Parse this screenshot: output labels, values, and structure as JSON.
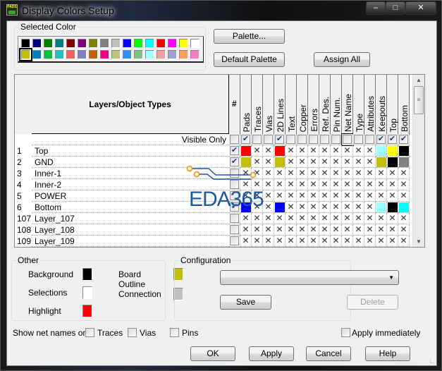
{
  "window": {
    "title": "Display Colors Setup",
    "icon_text": "PADS",
    "controls": [
      "minimize",
      "maximize",
      "close"
    ]
  },
  "selected_color": {
    "label": "Selected Color",
    "selected_index": 16,
    "palette": [
      "#000000",
      "#000080",
      "#008000",
      "#008080",
      "#800000",
      "#800080",
      "#808000",
      "#808080",
      "#c0c0c0",
      "#0000ff",
      "#00ff00",
      "#00ffff",
      "#ff0000",
      "#ff00ff",
      "#ffff00",
      "#ffffff",
      "#c0c000",
      "#0080c0",
      "#00c040",
      "#20c0c0",
      "#f06060",
      "#8080c0",
      "#c06010",
      "#f00080",
      "#c0c080",
      "#3090f0",
      "#80c080",
      "#a0ffff",
      "#f0a0a0",
      "#a0a0d0",
      "#ffa060",
      "#f080c0"
    ]
  },
  "buttons": {
    "palette": "Palette...",
    "default_palette": "Default Palette",
    "assign_all": "Assign All",
    "save": "Save",
    "delete": "Delete",
    "ok": "OK",
    "apply": "Apply",
    "cancel": "Cancel",
    "help": "Help"
  },
  "grid": {
    "header": "Layers/Object Types",
    "visible_only": "Visible Only",
    "columns": [
      "#",
      "Pads",
      "Traces",
      "Vias",
      "2D Lines",
      "Text",
      "Copper",
      "Errors",
      "Ref. Des.",
      "Pin Num.",
      "Net Name",
      "Type",
      "Attributes",
      "Keepouts",
      "Top",
      "Bottom"
    ],
    "visible_only_checks": [
      false,
      true,
      false,
      false,
      true,
      false,
      false,
      false,
      false,
      false,
      false,
      false,
      false,
      true,
      true,
      true
    ],
    "rows": [
      {
        "num": "1",
        "name": "Top",
        "checked": true,
        "cells": [
          "#ff0000",
          null,
          null,
          "#ff0000",
          null,
          null,
          null,
          null,
          null,
          null,
          null,
          null,
          "#99ffff",
          "#ffff00",
          "#000000"
        ]
      },
      {
        "num": "2",
        "name": "GND",
        "checked": true,
        "cells": [
          "#c0c000",
          null,
          null,
          "#c0c000",
          null,
          null,
          null,
          null,
          null,
          null,
          null,
          null,
          "#c0c000",
          "#000000",
          "#808080"
        ]
      },
      {
        "num": "3",
        "name": "Inner-1",
        "checked": false,
        "cells": [
          null,
          null,
          null,
          null,
          null,
          null,
          null,
          null,
          null,
          null,
          null,
          null,
          null,
          null,
          null
        ]
      },
      {
        "num": "4",
        "name": "Inner-2",
        "checked": false,
        "cells": [
          null,
          null,
          null,
          null,
          null,
          null,
          null,
          null,
          null,
          null,
          null,
          null,
          null,
          null,
          null
        ]
      },
      {
        "num": "5",
        "name": "POWER",
        "checked": false,
        "cells": [
          null,
          null,
          null,
          null,
          null,
          null,
          null,
          null,
          null,
          null,
          null,
          null,
          null,
          null,
          null
        ]
      },
      {
        "num": "6",
        "name": "Bottom",
        "checked": true,
        "cells": [
          "#0000ff",
          null,
          null,
          "#0000ff",
          null,
          null,
          null,
          null,
          null,
          null,
          null,
          null,
          "#99ffff",
          "#000000",
          "#00ffff"
        ]
      },
      {
        "num": "107",
        "name": "Layer_107",
        "checked": false,
        "cells": [
          null,
          null,
          null,
          null,
          null,
          null,
          null,
          null,
          null,
          null,
          null,
          null,
          null,
          null,
          null
        ]
      },
      {
        "num": "108",
        "name": "Layer_108",
        "checked": false,
        "cells": [
          null,
          null,
          null,
          null,
          null,
          null,
          null,
          null,
          null,
          null,
          null,
          null,
          null,
          null,
          null
        ]
      },
      {
        "num": "109",
        "name": "Layer_109",
        "checked": false,
        "cells": [
          null,
          null,
          null,
          null,
          null,
          null,
          null,
          null,
          null,
          null,
          null,
          null,
          null,
          null,
          null
        ]
      }
    ]
  },
  "other": {
    "label": "Other",
    "background": {
      "label": "Background",
      "color": "#000000"
    },
    "selections": {
      "label": "Selections",
      "color": "#ffffff"
    },
    "highlight": {
      "label": "Highlight",
      "color": "#ff0000"
    },
    "board_outline": {
      "label": "Board Outline",
      "color": "#c0c000"
    },
    "connection": {
      "label": "Connection",
      "color": "#c0c0c0"
    }
  },
  "configuration": {
    "label": "Configuration",
    "value": ""
  },
  "net_names": {
    "label": "Show net names on",
    "traces": "Traces",
    "vias": "Vias",
    "pins": "Pins"
  },
  "apply_immediately": "Apply immediately",
  "watermark": "EDA365"
}
